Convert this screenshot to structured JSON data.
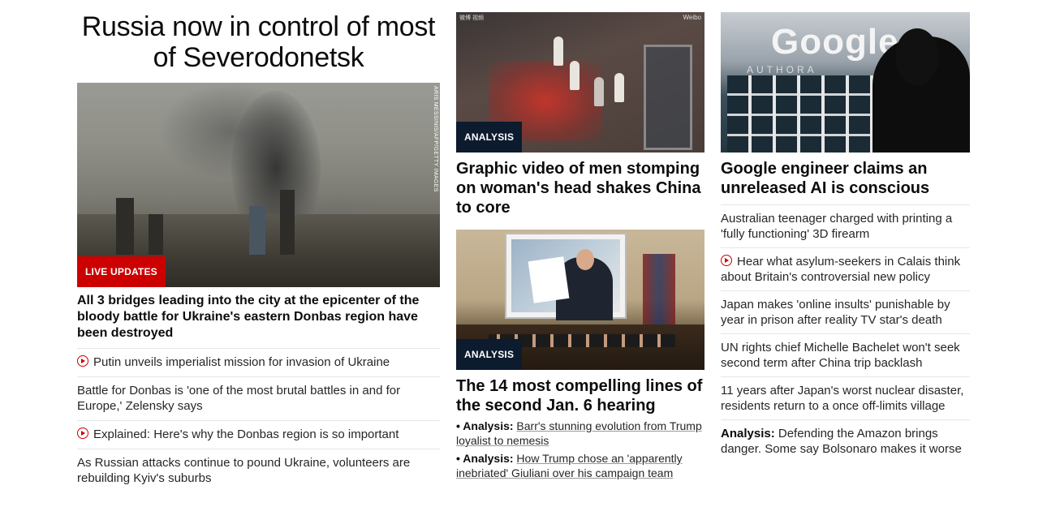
{
  "col1": {
    "headline": "Russia now in control of most of Severodonetsk",
    "image_credit": "ARIS MESSINIS/AFP/GETTY IMAGES",
    "badge": "LIVE UPDATES",
    "subheadline": "All 3 bridges leading into the city at the epicenter of the bloody battle for Ukraine's eastern Donbas region have been destroyed",
    "items": [
      {
        "video": true,
        "text": "Putin unveils imperialist mission for invasion of Ukraine"
      },
      {
        "video": false,
        "text": "Battle for Donbas is 'one of the most brutal battles in and for Europe,' Zelensky says"
      },
      {
        "video": true,
        "text": "Explained: Here's why the Donbas region is so important"
      },
      {
        "video": false,
        "text": "As Russian attacks continue to pound Ukraine, volunteers are rebuilding Kyiv's suburbs"
      }
    ]
  },
  "col2": {
    "story1": {
      "badge": "ANALYSIS",
      "watermark_left": "微博 视频",
      "watermark_right": "Weibo",
      "headline": "Graphic video of men stomping on woman's head shakes China to core"
    },
    "story2": {
      "badge": "ANALYSIS",
      "headline": "The 14 most compelling lines of the second Jan. 6 hearing",
      "bullets": [
        {
          "prefix": "Analysis:",
          "text": "Barr's stunning evolution from Trump loyalist to nemesis"
        },
        {
          "prefix": "Analysis:",
          "text": "How Trump chose an 'apparently inebriated' Giuliani over his campaign team"
        }
      ]
    }
  },
  "col3": {
    "image_text": "Google",
    "image_subtext": "AUTHORA",
    "headline": "Google engineer claims an unreleased AI is conscious",
    "items": [
      {
        "video": false,
        "prefix": "",
        "text": "Australian teenager charged with printing a 'fully functioning' 3D firearm"
      },
      {
        "video": true,
        "prefix": "",
        "text": "Hear what asylum-seekers in Calais think about Britain's controversial new policy"
      },
      {
        "video": false,
        "prefix": "",
        "text": "Japan makes 'online insults' punishable by year in prison after reality TV star's death"
      },
      {
        "video": false,
        "prefix": "",
        "text": "UN rights chief Michelle Bachelet won't seek second term after China trip backlash"
      },
      {
        "video": false,
        "prefix": "",
        "text": "11 years after Japan's worst nuclear disaster, residents return to a once off-limits village"
      },
      {
        "video": false,
        "prefix": "Analysis:",
        "text": "Defending the Amazon brings danger. Some say Bolsonaro makes it worse"
      }
    ]
  },
  "colors": {
    "accent_red": "#cc0000",
    "badge_dark": "#0c1b2e",
    "divider": "#e6e6e6"
  }
}
